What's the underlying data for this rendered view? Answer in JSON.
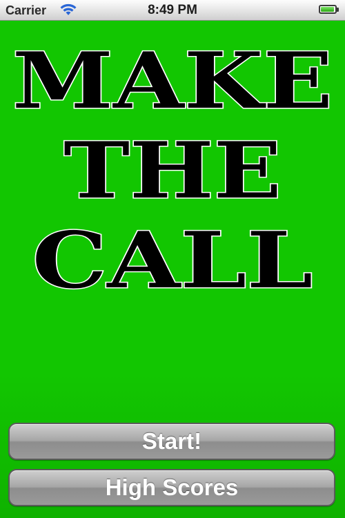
{
  "status_bar": {
    "carrier": "Carrier",
    "time": "8:49 PM",
    "wifi_icon": "wifi-icon",
    "battery_icon": "battery-icon",
    "battery_level": 0.95
  },
  "title": {
    "line1": "MAKE",
    "line2": "THE",
    "line3": "CALL"
  },
  "buttons": {
    "start_label": "Start!",
    "high_scores_label": "High Scores"
  },
  "colors": {
    "background": "#12c601",
    "title_fill": "#000000",
    "title_outline": "#ffffff",
    "button_text": "#ffffff"
  }
}
